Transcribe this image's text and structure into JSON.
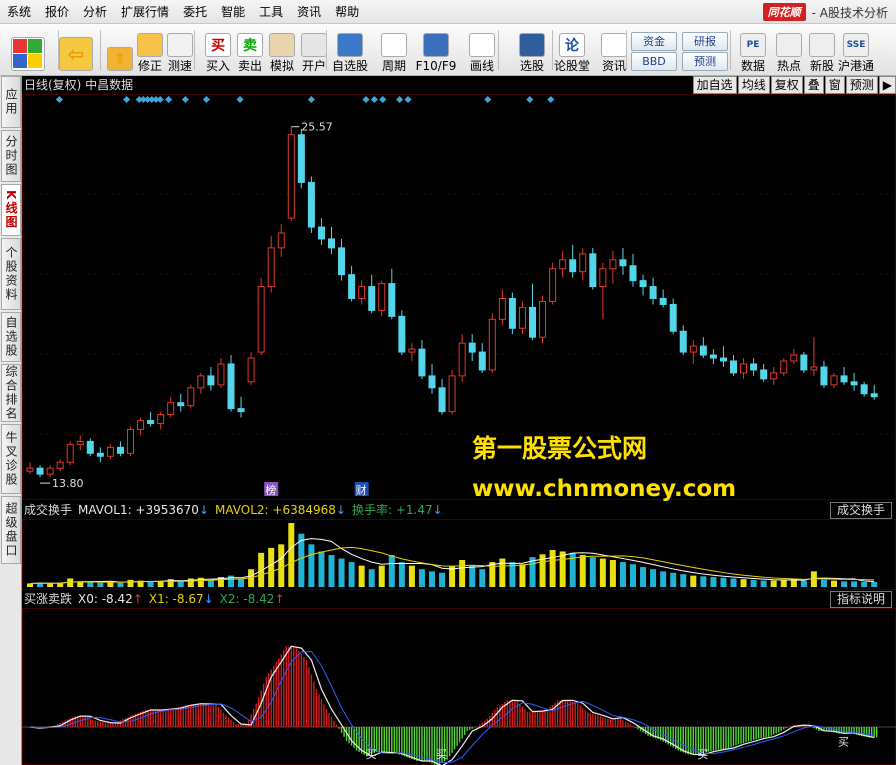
{
  "menu": {
    "items": [
      "系统",
      "报价",
      "分析",
      "扩展行情",
      "委托",
      "智能",
      "工具",
      "资讯",
      "帮助"
    ]
  },
  "brand": {
    "logo": "同花顺",
    "title": "- A股技术分析"
  },
  "toolbar": {
    "items": [
      {
        "label": "",
        "icon": "windows-icon"
      },
      {
        "label": "",
        "icon": "back-arrow-icon"
      },
      {
        "label": "",
        "icon": "up-down-arrow-icon"
      },
      {
        "label": "修正",
        "icon": "fix-icon"
      },
      {
        "label": "测速",
        "icon": "speed-icon"
      },
      {
        "label": "买入",
        "icon": "buy-icon",
        "glyph": "买"
      },
      {
        "label": "卖出",
        "icon": "sell-icon",
        "glyph": "卖"
      },
      {
        "label": "模拟",
        "icon": "hammer-icon"
      },
      {
        "label": "开户",
        "icon": "lock-icon"
      },
      {
        "label": "自选股",
        "icon": "star-icon"
      },
      {
        "label": "周期",
        "icon": "clock-icon"
      },
      {
        "label": "F10/F9",
        "icon": "f10-icon"
      },
      {
        "label": "画线",
        "icon": "pen-icon"
      },
      {
        "label": "选股",
        "icon": "screen-icon"
      },
      {
        "label": "论股堂",
        "icon": "discuss-icon",
        "glyph": "论"
      },
      {
        "label": "资讯",
        "icon": "news-icon"
      },
      {
        "label": "数据",
        "icon": "data-icon",
        "glyph": "PE"
      },
      {
        "label": "热点",
        "icon": "hot-icon"
      },
      {
        "label": "新股",
        "icon": "ipo-icon"
      },
      {
        "label": "沪港通",
        "icon": "hk-connect-icon",
        "glyph": "SSE"
      }
    ],
    "small_buttons": [
      "资金",
      "研报",
      "BBD",
      "预测"
    ]
  },
  "sidetabs": [
    "应用",
    "分时图",
    "K线图",
    "个股资料",
    "自选股",
    "综合排名",
    "牛叉诊股",
    "超级盘口"
  ],
  "sidetab_active": 2,
  "chart_header": {
    "title": "日线(复权)  中昌数据",
    "buttons": [
      "加自选",
      "均线",
      "复权",
      "叠",
      "窗",
      "预测",
      "▶"
    ]
  },
  "watermark": {
    "line1": "第一股票公式网",
    "line2": "www.chnmoney.com"
  },
  "chart_data": [
    {
      "type": "candlestick",
      "title": "日线(复权) 中昌数据",
      "max_label": "25.57",
      "min_label": "13.80",
      "event_markers": [
        "榜",
        "财"
      ],
      "ohlc": [
        [
          14.0,
          14.3,
          13.9,
          14.1
        ],
        [
          14.1,
          14.2,
          13.8,
          13.9
        ],
        [
          13.9,
          14.2,
          13.8,
          14.1
        ],
        [
          14.1,
          14.4,
          14.0,
          14.3
        ],
        [
          14.3,
          15.0,
          14.2,
          14.9
        ],
        [
          14.9,
          15.2,
          14.7,
          15.0
        ],
        [
          15.0,
          15.1,
          14.5,
          14.6
        ],
        [
          14.6,
          14.8,
          14.3,
          14.5
        ],
        [
          14.5,
          14.9,
          14.4,
          14.8
        ],
        [
          14.8,
          15.0,
          14.5,
          14.6
        ],
        [
          14.6,
          15.5,
          14.5,
          15.4
        ],
        [
          15.4,
          15.8,
          15.2,
          15.7
        ],
        [
          15.7,
          16.0,
          15.5,
          15.6
        ],
        [
          15.6,
          16.0,
          15.4,
          15.9
        ],
        [
          15.9,
          16.5,
          15.8,
          16.3
        ],
        [
          16.3,
          16.6,
          16.0,
          16.2
        ],
        [
          16.2,
          16.9,
          16.1,
          16.8
        ],
        [
          16.8,
          17.3,
          16.6,
          17.2
        ],
        [
          17.2,
          17.5,
          16.7,
          16.9
        ],
        [
          16.9,
          17.8,
          16.8,
          17.6
        ],
        [
          17.6,
          17.9,
          16.0,
          16.1
        ],
        [
          16.1,
          16.5,
          15.8,
          16.0
        ],
        [
          17.0,
          18.0,
          16.9,
          17.8
        ],
        [
          18.0,
          20.5,
          17.9,
          20.2
        ],
        [
          20.2,
          21.9,
          20.0,
          21.5
        ],
        [
          21.5,
          22.3,
          21.2,
          22.0
        ],
        [
          22.5,
          25.57,
          22.4,
          25.3
        ],
        [
          25.3,
          25.5,
          23.5,
          23.7
        ],
        [
          23.7,
          23.9,
          22.0,
          22.2
        ],
        [
          22.2,
          22.5,
          21.6,
          21.8
        ],
        [
          21.8,
          22.2,
          21.3,
          21.5
        ],
        [
          21.5,
          21.8,
          20.4,
          20.6
        ],
        [
          20.6,
          20.9,
          19.7,
          19.8
        ],
        [
          19.8,
          20.4,
          19.6,
          20.2
        ],
        [
          20.2,
          20.6,
          19.3,
          19.4
        ],
        [
          19.4,
          20.4,
          19.2,
          20.3
        ],
        [
          20.3,
          20.8,
          19.1,
          19.2
        ],
        [
          19.2,
          19.4,
          17.9,
          18.0
        ],
        [
          18.0,
          18.3,
          17.7,
          18.1
        ],
        [
          18.1,
          18.4,
          17.1,
          17.2
        ],
        [
          17.2,
          17.6,
          16.6,
          16.8
        ],
        [
          16.8,
          17.1,
          15.9,
          16.0
        ],
        [
          16.0,
          17.4,
          15.9,
          17.2
        ],
        [
          17.2,
          18.6,
          17.0,
          18.3
        ],
        [
          18.3,
          18.6,
          17.7,
          18.0
        ],
        [
          18.0,
          18.3,
          17.3,
          17.4
        ],
        [
          17.4,
          19.3,
          17.3,
          19.1
        ],
        [
          19.1,
          20.1,
          18.9,
          19.8
        ],
        [
          19.8,
          20.0,
          18.6,
          18.8
        ],
        [
          18.8,
          19.7,
          18.6,
          19.5
        ],
        [
          19.5,
          20.3,
          18.4,
          18.5
        ],
        [
          18.5,
          19.9,
          18.3,
          19.7
        ],
        [
          19.7,
          21.0,
          19.6,
          20.8
        ],
        [
          20.8,
          21.4,
          20.5,
          21.1
        ],
        [
          21.1,
          21.6,
          20.5,
          20.7
        ],
        [
          20.7,
          21.5,
          20.4,
          21.3
        ],
        [
          21.3,
          21.5,
          20.1,
          20.2
        ],
        [
          20.2,
          21.0,
          19.1,
          20.8
        ],
        [
          20.8,
          21.4,
          20.3,
          21.1
        ],
        [
          21.1,
          21.5,
          20.6,
          20.9
        ],
        [
          20.9,
          21.3,
          20.2,
          20.4
        ],
        [
          20.4,
          20.6,
          19.9,
          20.2
        ],
        [
          20.2,
          20.5,
          19.6,
          19.8
        ],
        [
          19.8,
          20.1,
          19.5,
          19.6
        ],
        [
          19.6,
          19.8,
          18.6,
          18.7
        ],
        [
          18.7,
          18.9,
          17.9,
          18.0
        ],
        [
          18.0,
          18.4,
          17.6,
          18.2
        ],
        [
          18.2,
          18.5,
          17.8,
          17.9
        ],
        [
          17.9,
          18.1,
          17.6,
          17.8
        ],
        [
          17.8,
          18.2,
          17.5,
          17.7
        ],
        [
          17.7,
          17.9,
          17.2,
          17.3
        ],
        [
          17.3,
          17.8,
          17.1,
          17.6
        ],
        [
          17.6,
          17.8,
          17.2,
          17.4
        ],
        [
          17.4,
          17.6,
          17.0,
          17.1
        ],
        [
          17.1,
          17.5,
          16.9,
          17.3
        ],
        [
          17.3,
          17.8,
          17.2,
          17.7
        ],
        [
          17.7,
          18.1,
          17.6,
          17.9
        ],
        [
          17.9,
          18.0,
          17.3,
          17.4
        ],
        [
          17.4,
          18.5,
          17.2,
          17.5
        ],
        [
          17.5,
          17.7,
          16.8,
          16.9
        ],
        [
          16.9,
          17.3,
          16.8,
          17.2
        ],
        [
          17.2,
          17.5,
          16.9,
          17.0
        ],
        [
          17.0,
          17.3,
          16.7,
          16.9
        ],
        [
          16.9,
          17.0,
          16.5,
          16.6
        ],
        [
          16.6,
          16.9,
          16.4,
          16.5
        ]
      ]
    },
    {
      "type": "bar",
      "title": "成交换手",
      "series": [
        {
          "name": "MAVOL1",
          "value_label": "+3953670"
        },
        {
          "name": "MAVOL2",
          "value_label": "+6384968"
        },
        {
          "name": "换手率",
          "value_label": "+1.47"
        }
      ],
      "values": [
        0.5,
        0.6,
        0.5,
        0.6,
        1.2,
        0.8,
        0.7,
        0.6,
        0.7,
        0.6,
        1.0,
        0.9,
        0.7,
        0.8,
        1.1,
        0.9,
        1.2,
        1.3,
        1.0,
        1.4,
        1.6,
        1.2,
        2.5,
        4.8,
        5.5,
        6.0,
        9.0,
        7.5,
        6.0,
        5.0,
        4.5,
        4.0,
        3.5,
        3.0,
        2.5,
        3.0,
        4.5,
        3.5,
        3.0,
        2.5,
        2.2,
        2.0,
        3.0,
        3.8,
        3.0,
        2.5,
        3.5,
        4.0,
        3.5,
        3.2,
        4.2,
        4.6,
        5.2,
        5.0,
        4.8,
        4.5,
        4.2,
        4.0,
        3.8,
        3.5,
        3.2,
        2.8,
        2.5,
        2.2,
        2.0,
        1.8,
        1.6,
        1.5,
        1.4,
        1.3,
        1.2,
        1.1,
        1.0,
        0.9,
        0.9,
        1.0,
        1.1,
        0.9,
        2.2,
        1.0,
        0.9,
        0.8,
        0.8,
        0.7,
        0.7
      ],
      "hollow_rate": 0.45
    },
    {
      "type": "bar",
      "title": "买涨卖跌",
      "series": [
        {
          "name": "X0",
          "value_label": "-8.42"
        },
        {
          "name": "X1",
          "value_label": "-8.67"
        },
        {
          "name": "X2",
          "value_label": "-8.42"
        }
      ],
      "zero_label": "0",
      "signal_label": "买"
    }
  ],
  "vol_panel": {
    "name": "成交换手",
    "items": [
      {
        "text": "MAVOL1: +3953670",
        "arrow": "↓",
        "color": "#e6e6e6"
      },
      {
        "text": "MAVOL2: +6384968",
        "arrow": "↓",
        "color": "#e6d200"
      },
      {
        "text": "换手率: +1.47",
        "arrow": "↓",
        "color": "#2fa84f"
      }
    ],
    "button": "成交换手"
  },
  "ind_panel": {
    "name": "买涨卖跌",
    "items": [
      {
        "text": "X0: -8.42",
        "arrow": "↑",
        "color": "#e6e6e6"
      },
      {
        "text": "X1: -8.67",
        "arrow": "↓",
        "color": "#e6d200"
      },
      {
        "text": "X2: -8.42",
        "arrow": "↑",
        "color": "#2fa84f"
      }
    ],
    "button": "指标说明"
  },
  "colors": {
    "up": "#e0392b",
    "down": "#54d6ea",
    "vol_up": "#e8e010",
    "vol_down": "#1fb4d6",
    "ind_pos": "#d41c1c",
    "ind_neg": "#55d636"
  }
}
